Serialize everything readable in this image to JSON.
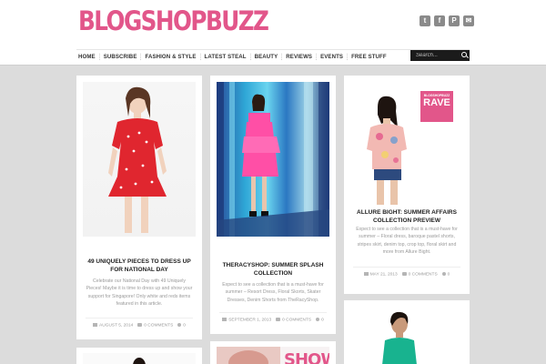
{
  "header": {
    "logo": "BLOGSHOPBUZZ",
    "social_icons": [
      "twitter-icon",
      "facebook-icon",
      "pinterest-icon",
      "email-icon"
    ],
    "social_glyphs": [
      "t",
      "f",
      "P",
      "✉"
    ]
  },
  "nav": {
    "items": [
      "HOME",
      "SUBSCRIBE",
      "FASHION & STYLE",
      "LATEST STEAL",
      "BEAUTY",
      "REVIEWS",
      "EVENTS",
      "FREE STUFF"
    ],
    "search_placeholder": "Search..."
  },
  "posts": [
    {
      "title": "49 UNIQUELY PIECES TO DRESS UP FOR NATIONAL DAY",
      "excerpt": "Celebrate our National Day with 49 Uniquely Pieces! Maybe it is time to dress up and show your support for Singapore! Only white and reds items featured in this article.",
      "date": "AUGUST 5, 2014",
      "comments": "0 COMMENTS",
      "likes": "0"
    },
    {
      "title": "THERACYSHOP: SUMMER SPLASH COLLECTION",
      "excerpt": "Expect to see a collection that is a must-have for summer – Resort Dress, Floral Skorts, Skater Dresses, Denim Shorts from TheRacyShop.",
      "date": "SEPTEMBER 1, 2013",
      "comments": "0 COMMENTS",
      "likes": "0"
    },
    {
      "title": "ALLURE BIGHT: SUMMER AFFAIRS COLLECTION PREVIEW",
      "excerpt": "Expect to see a collection that is a must-have for summer – Floral dress, baroque pastel shorts, stripes skirt, denim top, crop top, floral skirt and more from Allure Bight.",
      "date": "MAY 21, 2013",
      "comments": "0 COMMENTS",
      "likes": "0"
    }
  ],
  "badges": {
    "rave_top": "BLOGSHOPBUZZ",
    "rave_main": "RAVE",
    "show": "SHOW"
  },
  "colors": {
    "brand_pink": "#e2568a",
    "background": "#dcdcdc",
    "nav_search_bg": "#1b1b1b"
  }
}
